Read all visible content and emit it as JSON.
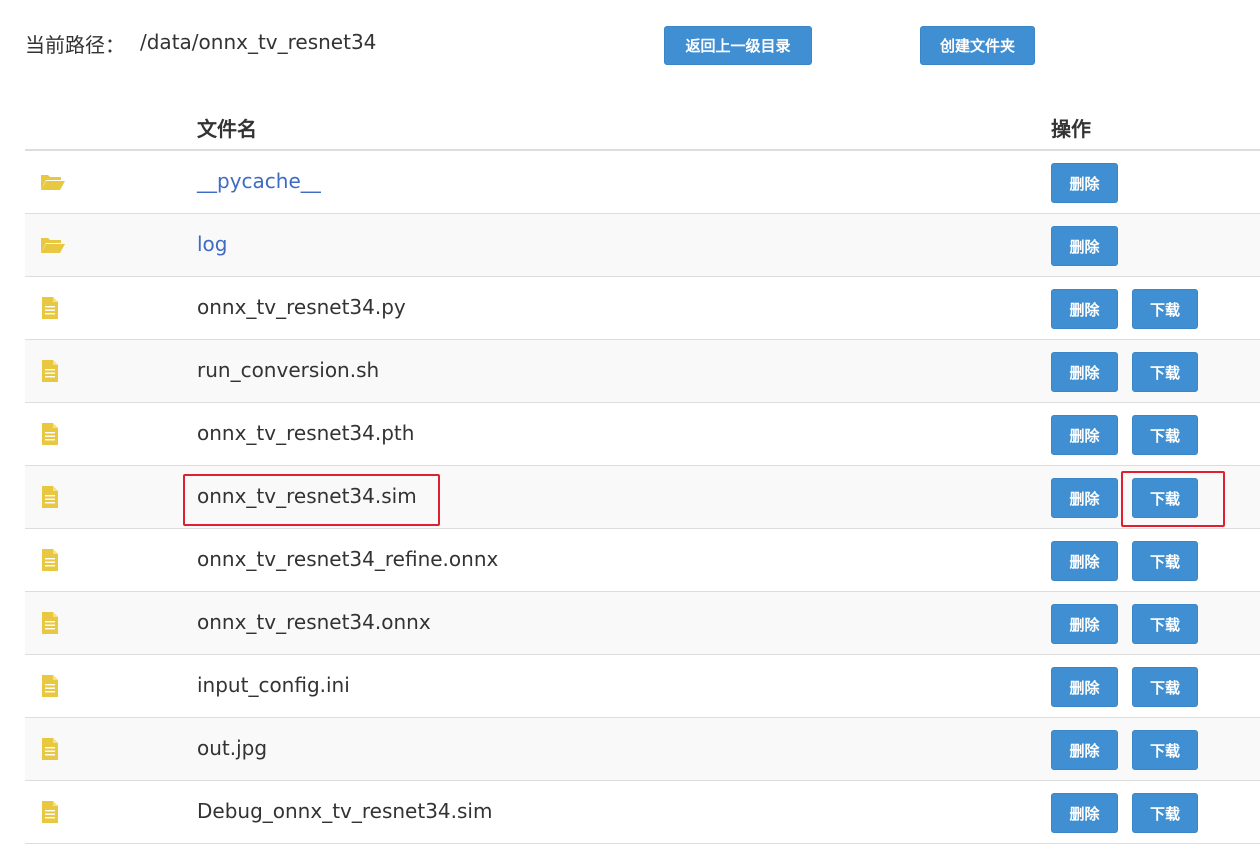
{
  "header": {
    "path_label": "当前路径：",
    "path_value": "/data/onnx_tv_resnet34",
    "up_button": "返回上一级目录",
    "mkdir_button": "创建文件夹"
  },
  "table": {
    "col_name": "文件名",
    "col_ops": "操作",
    "delete_label": "删除",
    "download_label": "下载",
    "rows": [
      {
        "name": "__pycache__",
        "type": "folder"
      },
      {
        "name": "log",
        "type": "folder"
      },
      {
        "name": "onnx_tv_resnet34.py",
        "type": "file"
      },
      {
        "name": "run_conversion.sh",
        "type": "file"
      },
      {
        "name": "onnx_tv_resnet34.pth",
        "type": "file"
      },
      {
        "name": "onnx_tv_resnet34.sim",
        "type": "file"
      },
      {
        "name": "onnx_tv_resnet34_refine.onnx",
        "type": "file"
      },
      {
        "name": "onnx_tv_resnet34.onnx",
        "type": "file"
      },
      {
        "name": "input_config.ini",
        "type": "file"
      },
      {
        "name": "out.jpg",
        "type": "file"
      },
      {
        "name": "Debug_onnx_tv_resnet34.sim",
        "type": "file"
      }
    ]
  },
  "colors": {
    "button": "#3f8fd2",
    "folder_link": "#3e6bc4",
    "icon": "#e8c840",
    "highlight": "#e02030"
  },
  "icons": {
    "folder": "folder-open-icon",
    "file": "file-text-icon"
  }
}
